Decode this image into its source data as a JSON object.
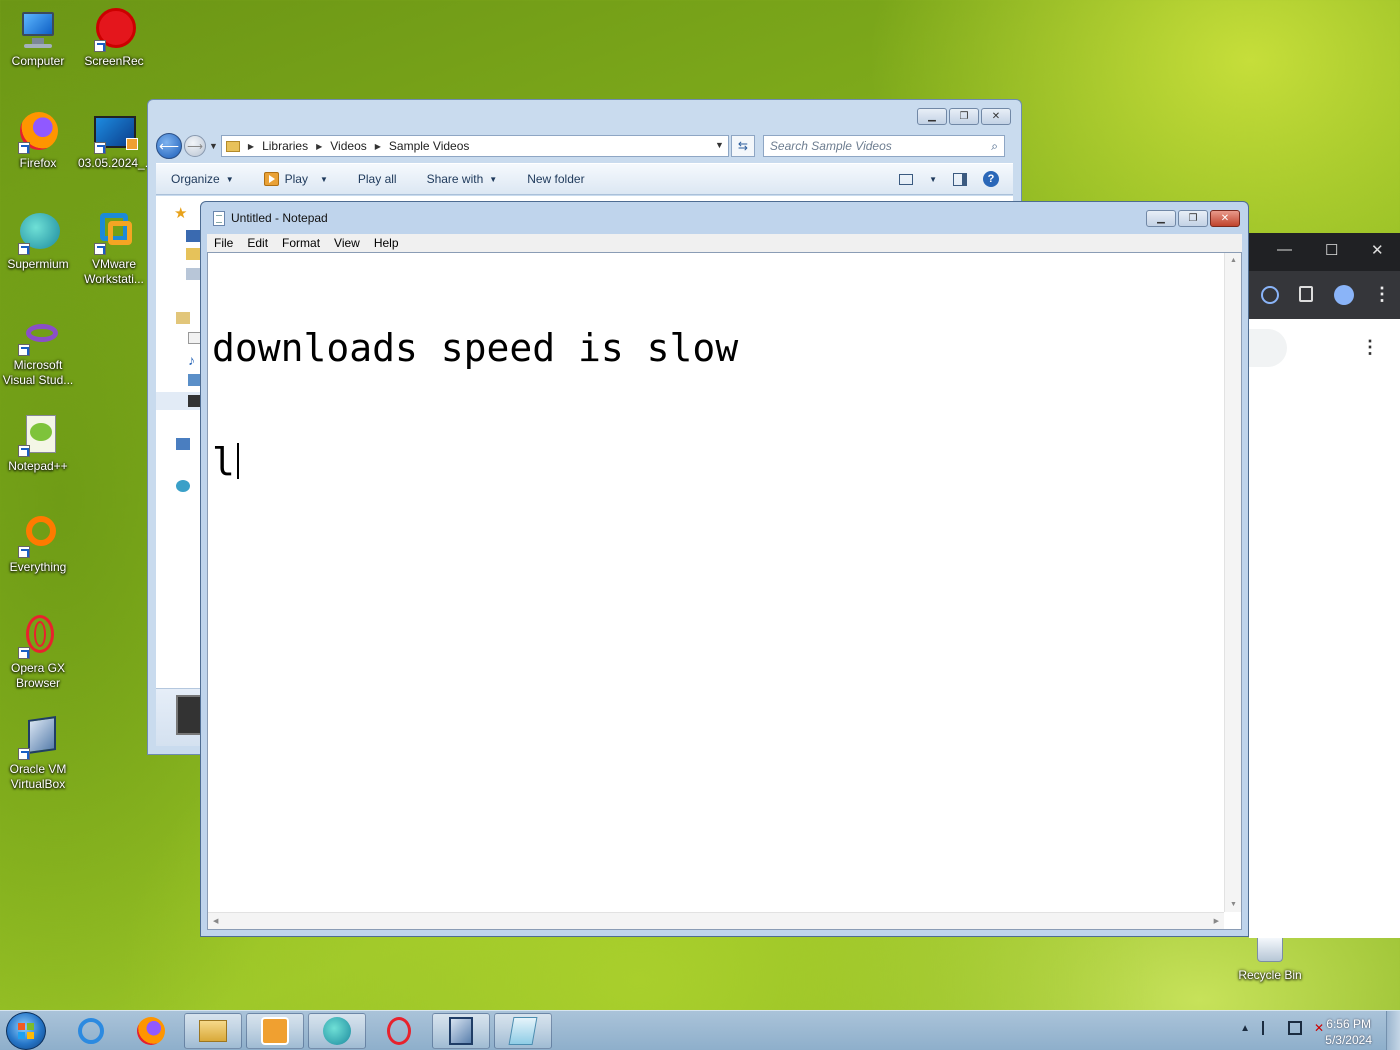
{
  "desktop": {
    "icons": [
      {
        "label": "Computer",
        "icon": "computer-icon"
      },
      {
        "label": "ScreenRec",
        "icon": "screenrec-icon"
      },
      {
        "label": "Firefox",
        "icon": "firefox-icon"
      },
      {
        "label": "03.05.2024_...",
        "icon": "video-file-icon"
      },
      {
        "label": "Supermium",
        "icon": "supermium-icon"
      },
      {
        "label": "VMware Workstati...",
        "icon": "vmware-icon"
      },
      {
        "label": "Microsoft Visual Stud...",
        "icon": "visual-studio-icon"
      },
      {
        "label": "Notepad++",
        "icon": "notepadpp-icon"
      },
      {
        "label": "Everything",
        "icon": "everything-icon"
      },
      {
        "label": "Opera GX Browser",
        "icon": "opera-gx-icon"
      },
      {
        "label": "Oracle VM VirtualBox",
        "icon": "virtualbox-icon"
      }
    ],
    "recycle_bin": "Recycle Bin"
  },
  "explorer": {
    "breadcrumb": [
      "Libraries",
      "Videos",
      "Sample Videos"
    ],
    "search_placeholder": "Search Sample Videos",
    "commands": {
      "organize": "Organize",
      "play": "Play",
      "play_all": "Play all",
      "share_with": "Share with",
      "new_folder": "New folder"
    }
  },
  "notepad": {
    "title": "Untitled - Notepad",
    "menu": [
      "File",
      "Edit",
      "Format",
      "View",
      "Help"
    ],
    "text_line1": "downloads speed is slow",
    "text_line2": "l"
  },
  "chrome": {
    "window_controls": [
      "—",
      "☐",
      "✕"
    ]
  },
  "taskbar": {
    "apps": [
      "internet-explorer-icon",
      "firefox-icon",
      "explorer-icon",
      "media-player-icon",
      "supermium-icon",
      "opera-icon",
      "virtualbox-icon",
      "notepad-icon"
    ],
    "time": "6:56 PM",
    "date": "5/3/2024"
  },
  "colors": {
    "accent": "#2a67b8",
    "notepad_frame": "#bfd4ec",
    "taskbar": "#9fbad3"
  }
}
